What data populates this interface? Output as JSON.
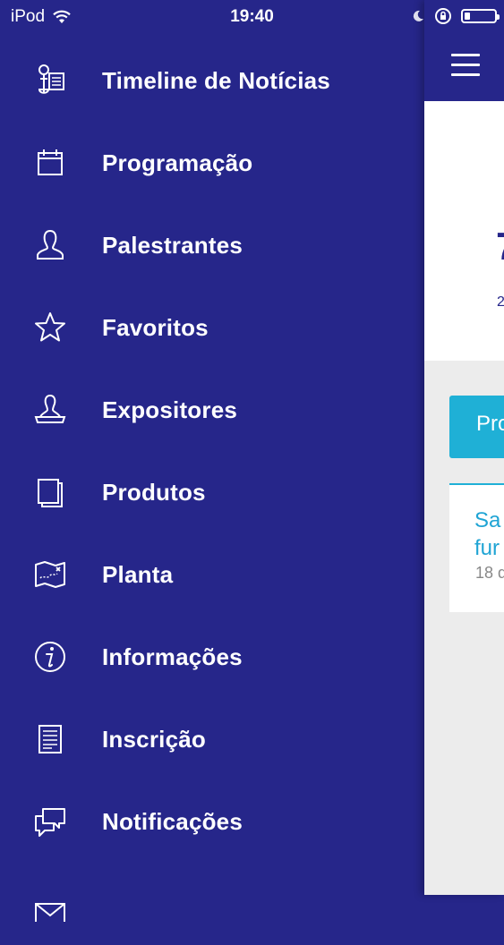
{
  "status_bar": {
    "carrier": "iPod",
    "time": "19:40",
    "battery_level": 0.2
  },
  "menu": {
    "items": [
      {
        "label": "Timeline de Notícias",
        "icon": "news-timeline-icon"
      },
      {
        "label": "Programação",
        "icon": "calendar-icon"
      },
      {
        "label": "Palestrantes",
        "icon": "speaker-person-icon"
      },
      {
        "label": "Favoritos",
        "icon": "star-icon"
      },
      {
        "label": "Expositores",
        "icon": "exhibitor-stand-icon"
      },
      {
        "label": "Produtos",
        "icon": "products-pages-icon"
      },
      {
        "label": "Planta",
        "icon": "floor-map-icon"
      },
      {
        "label": "Informações",
        "icon": "info-icon"
      },
      {
        "label": "Inscrição",
        "icon": "registration-document-icon"
      },
      {
        "label": "Notificações",
        "icon": "chat-bubbles-icon"
      },
      {
        "label": "",
        "icon": "mail-icon"
      }
    ]
  },
  "content": {
    "hero_big": "7",
    "hero_small": "2",
    "card_label": "Pro",
    "news_title_line1": "Sa",
    "news_title_line2": "fur",
    "news_date": "18 d"
  },
  "colors": {
    "primary": "#26268a",
    "accent": "#1fb0d6",
    "link": "#1fa4d4"
  }
}
